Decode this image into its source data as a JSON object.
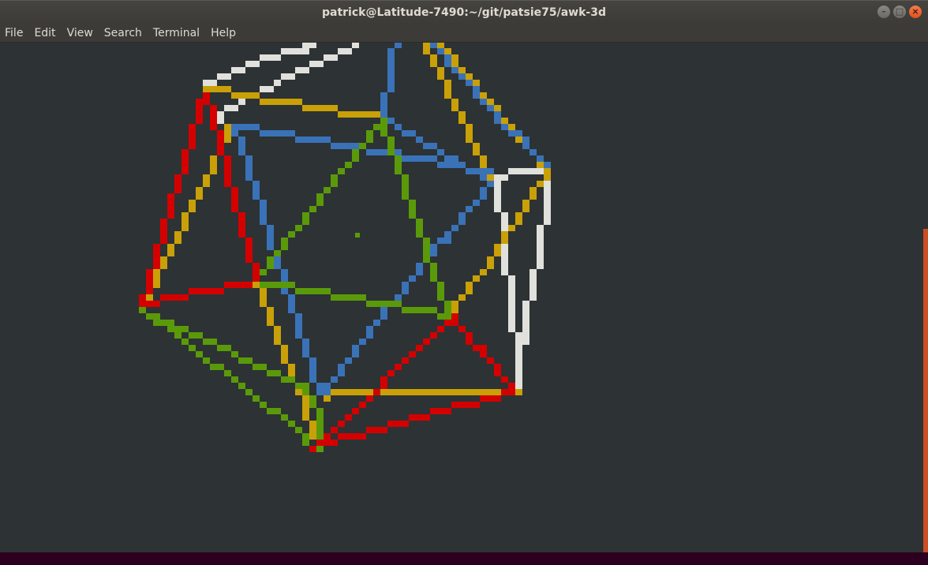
{
  "window": {
    "title": "patrick@Latitude-7490:~/git/patsie75/awk-3d"
  },
  "controls": {
    "minimize": "–",
    "maximize": "□",
    "close": "×"
  },
  "menu": {
    "items": [
      "File",
      "Edit",
      "View",
      "Search",
      "Terminal",
      "Help"
    ]
  },
  "scene": {
    "colors": {
      "white": "#e0e0dc",
      "yellow": "#c9a008",
      "blue": "#3a72b8",
      "green": "#5a9a0a",
      "red": "#d40000",
      "background": "#2d3234"
    }
  }
}
